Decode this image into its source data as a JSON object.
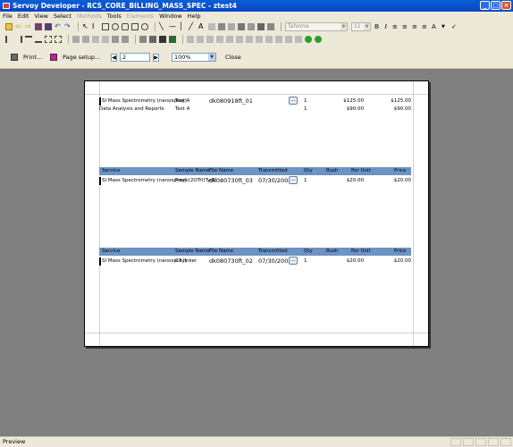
{
  "window": {
    "title": "Servoy Developer - RCS_CORE_BILLING_MASS_SPEC - ztest4"
  },
  "menu": [
    {
      "label": "File",
      "enabled": true
    },
    {
      "label": "Edit",
      "enabled": true
    },
    {
      "label": "View",
      "enabled": true
    },
    {
      "label": "Select",
      "enabled": true
    },
    {
      "label": "Methods",
      "enabled": false
    },
    {
      "label": "Tools",
      "enabled": true
    },
    {
      "label": "Elements",
      "enabled": false
    },
    {
      "label": "Window",
      "enabled": true
    },
    {
      "label": "Help",
      "enabled": true
    }
  ],
  "format_toolbar": {
    "font": "Tahoma",
    "size": "11",
    "bold": "B",
    "italic": "I"
  },
  "preview": {
    "print_label": "Print...",
    "page_setup_label": "Page setup...",
    "page": "2",
    "zoom": "100%",
    "close_label": "Close"
  },
  "report": {
    "headers": [
      "Service",
      "Sample Name",
      "File Name",
      "Transmitted",
      "Qty",
      "Rush",
      "Per Unit",
      "Price"
    ],
    "block1": [
      {
        "service": "SI Mass Spectrometry (nanospray)",
        "sample": "Test A",
        "file": "dk080918ft_01",
        "transmitted": "",
        "qty": "1",
        "rush": "",
        "unit": "$125.00",
        "price": "$125.00"
      },
      {
        "service": "Data Analysis and Reports",
        "sample": "Test A",
        "file": "",
        "transmitted": "",
        "qty": "1",
        "rush": "",
        "unit": "$90.00",
        "price": "$90.00"
      }
    ],
    "block2": [
      {
        "service": "SI Mass Spectrometry (nanospray)",
        "sample": "Fmoc(2OTrI)TyrO",
        "file": "dk080730ft_03",
        "transmitted": "07/30/2008",
        "qty": "1",
        "rush": "",
        "unit": "$20.00",
        "price": "$20.00"
      }
    ],
    "block3": [
      {
        "service": "SI Mass Spectrometry (nanospray)",
        "sample": "C3 linker",
        "file": "dk080730ft_02",
        "transmitted": "07/30/2008",
        "qty": "1",
        "rush": "",
        "unit": "$20.00",
        "price": "$20.00"
      }
    ],
    "ellipsis": "..."
  },
  "status": {
    "text": "Preview"
  },
  "colors": {
    "header": "#6b93c4",
    "canvas": "#808080",
    "titlebar": "#0a5fd8"
  }
}
